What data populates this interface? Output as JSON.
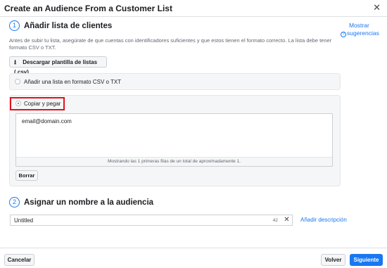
{
  "dialog": {
    "title": "Create an Audience From a Customer List",
    "close_icon": "close-icon"
  },
  "step1": {
    "number": "1",
    "title": "Añadir lista de clientes",
    "hint_line1": "Mostrar",
    "hint_line2": "sugerencias",
    "hint_icon": "?",
    "description": "Antes de subir tu lista, asegúrate de que cuentas con identificadores suficientes y que estos tienen el formato correcto. La lista debe tener formato CSV o TXT.",
    "download_label": "Descargar plantilla de listas (.csv)",
    "download_icon": "download-icon",
    "option_upload": "Añadir una lista en formato CSV o TXT",
    "option_paste": "Copiar y pegar",
    "paste_value": "email@domain.com",
    "preview_note": "Mostrando las 1 primeras filas de un total de aproximadamente 1.",
    "clear_label": "Borrar"
  },
  "step2": {
    "number": "2",
    "title": "Asignar un nombre a la audiencia",
    "name_value": "Untitled",
    "char_count": "42",
    "add_description": "Añadir descripción"
  },
  "footer": {
    "cancel_label": "Cancelar",
    "back_label": "Volver",
    "next_label": "Siguiente"
  },
  "colors": {
    "accent": "#1877f2",
    "highlight": "#e0131c"
  }
}
